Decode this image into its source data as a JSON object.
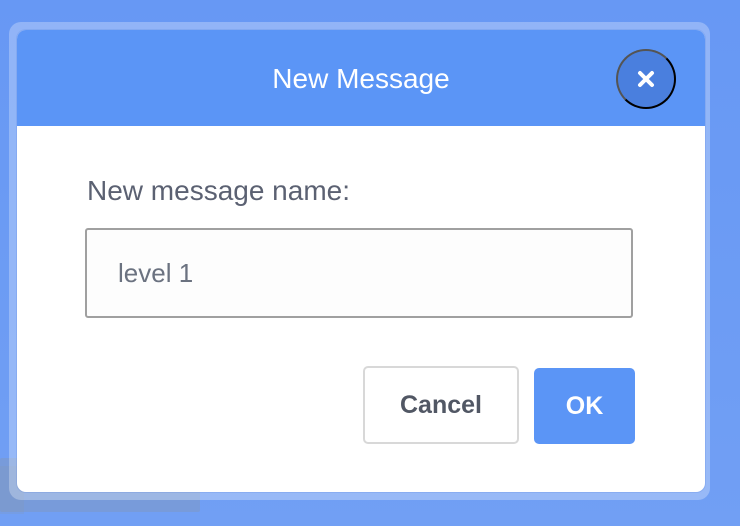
{
  "dialog": {
    "title": "New Message",
    "close_icon": "close-icon",
    "field_label": "New message name:",
    "input_value": "level 1",
    "cancel_label": "Cancel",
    "ok_label": "OK"
  },
  "colors": {
    "accent": "#5b95f6",
    "close_button": "#4a7fde",
    "background": "#6f9ef5",
    "text_primary": "#5b6172"
  }
}
